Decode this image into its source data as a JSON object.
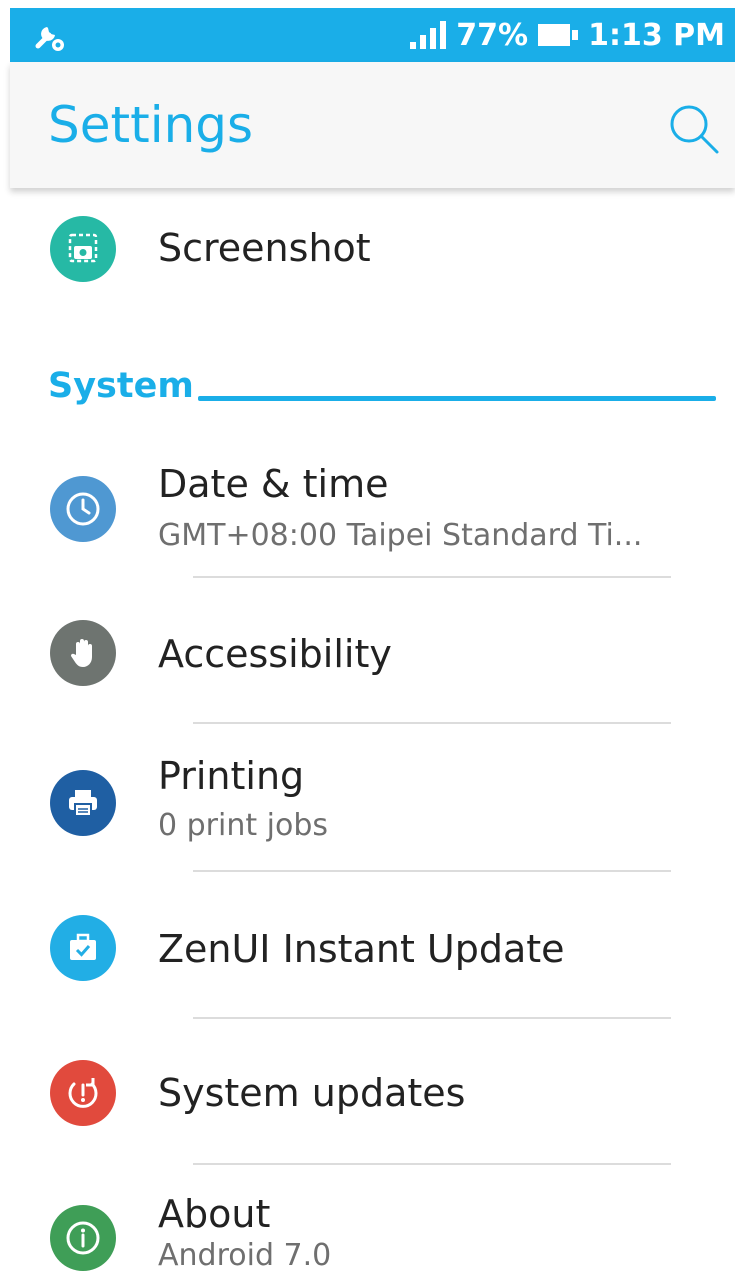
{
  "status_bar": {
    "battery_percent": "77%",
    "time": "1:13 PM",
    "icons": [
      "settings-wrench-icon",
      "signal-icon",
      "battery-icon"
    ]
  },
  "app_bar": {
    "title": "Settings",
    "search_icon": "search-icon"
  },
  "items_top": [
    {
      "title": "Screenshot",
      "icon": "screenshot-icon",
      "color": "#26b9a5"
    }
  ],
  "section": {
    "title": "System"
  },
  "system_items": [
    {
      "title": "Date & time",
      "subtitle": "GMT+08:00 Taipei Standard Ti...",
      "icon": "clock-icon",
      "color": "#4f98d2"
    },
    {
      "title": "Accessibility",
      "icon": "hand-icon",
      "color": "#6e7470"
    },
    {
      "title": "Printing",
      "subtitle": "0 print jobs",
      "icon": "printer-icon",
      "color": "#1f5fa3"
    },
    {
      "title": "ZenUI Instant Update",
      "icon": "briefcase-check-icon",
      "color": "#22aee5"
    },
    {
      "title": "System updates",
      "icon": "system-update-icon",
      "color": "#e14a3d"
    },
    {
      "title": "About",
      "subtitle": "Android 7.0",
      "icon": "info-icon",
      "color": "#3f9e57"
    }
  ]
}
